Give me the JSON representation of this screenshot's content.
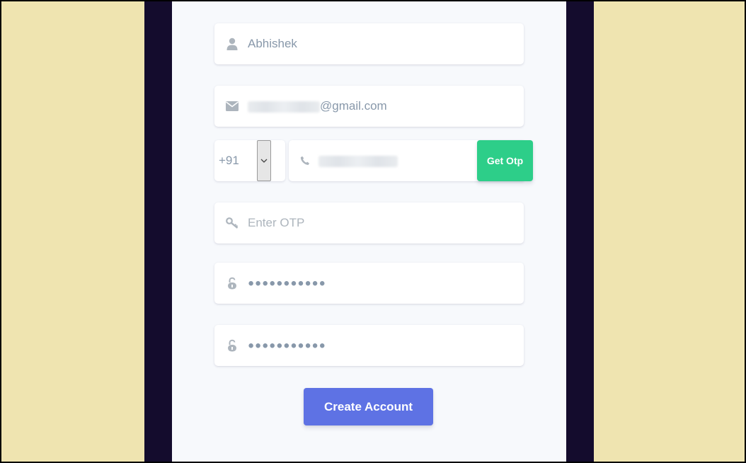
{
  "form": {
    "name": {
      "value": "Abhishek",
      "icon": "user-icon"
    },
    "email": {
      "value_suffix": "@gmail.com",
      "icon": "envelope-icon"
    },
    "phone": {
      "country_code": "+91",
      "icon": "phone-icon",
      "select_icon": "chevron-down-icon"
    },
    "otp": {
      "placeholder": "Enter OTP",
      "icon": "key-icon"
    },
    "password": {
      "value": "●●●●●●●●●●●",
      "icon": "unlock-icon"
    },
    "confirm_password": {
      "value": "●●●●●●●●●●●",
      "icon": "unlock-icon"
    },
    "get_otp_label": "Get Otp",
    "submit_label": "Create Account"
  },
  "colors": {
    "outer_background": "#efe4b0",
    "dark_band": "#140c2d",
    "panel": "#f7f9fc",
    "success": "#2dce89",
    "primary": "#5e72e4",
    "icon": "#adb5bd"
  }
}
